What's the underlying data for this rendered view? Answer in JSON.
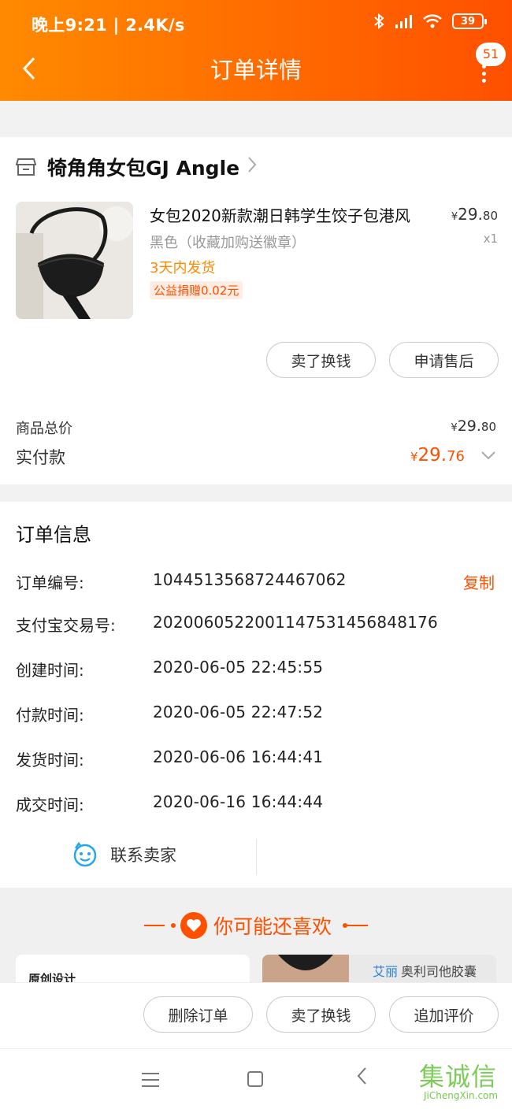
{
  "status_bar": {
    "time_speed": "晚上9:21 | 2.4K/s",
    "battery": "39"
  },
  "header": {
    "title": "订单详情",
    "badge": "51"
  },
  "shop": {
    "name": "犄角角女包GJ Angle"
  },
  "product": {
    "name": "女包2020新款潮日韩学生饺子包港风",
    "spec": "黑色（收藏加购送徽章）",
    "shipping": "3天内发货",
    "charity_tag": "公益捐赠0.02元",
    "price_symbol": "¥",
    "price_int": "29.",
    "price_dec": "80",
    "quantity": "x1"
  },
  "item_actions": {
    "sell_label": "卖了换钱",
    "after_sale_label": "申请售后"
  },
  "summary": {
    "total_label": "商品总价",
    "total_symbol": "¥",
    "total_int": "29.",
    "total_dec": "80",
    "paid_label": "实付款",
    "paid_symbol": "¥",
    "paid_int": "29.",
    "paid_dec": "76"
  },
  "order_info": {
    "title": "订单信息",
    "copy_label": "复制",
    "rows": [
      {
        "label": "订单编号:",
        "value": "1044513568724467062"
      },
      {
        "label": "支付宝交易号:",
        "value": "2020060522001147531456848176"
      },
      {
        "label": "创建时间:",
        "value": "2020-06-05 22:45:55"
      },
      {
        "label": "付款时间:",
        "value": "2020-06-05 22:47:52"
      },
      {
        "label": "发货时间:",
        "value": "2020-06-06 16:44:41"
      },
      {
        "label": "成交时间:",
        "value": "2020-06-16 16:44:44"
      }
    ],
    "contact_label": "联系卖家"
  },
  "recommend": {
    "title": "你可能还喜欢",
    "tile1_label": "原创设计",
    "ad_brand": "艾丽",
    "ad_text": "奥利司他胶囊"
  },
  "bottom_actions": {
    "delete_label": "删除订单",
    "sell_label": "卖了换钱",
    "review_label": "追加评价"
  },
  "watermark": {
    "cn": "集诚信",
    "en": "JiChengXin.com"
  },
  "colors": {
    "accent": "#ff5000",
    "header_start": "#ff8a00",
    "header_end": "#ff5000"
  }
}
